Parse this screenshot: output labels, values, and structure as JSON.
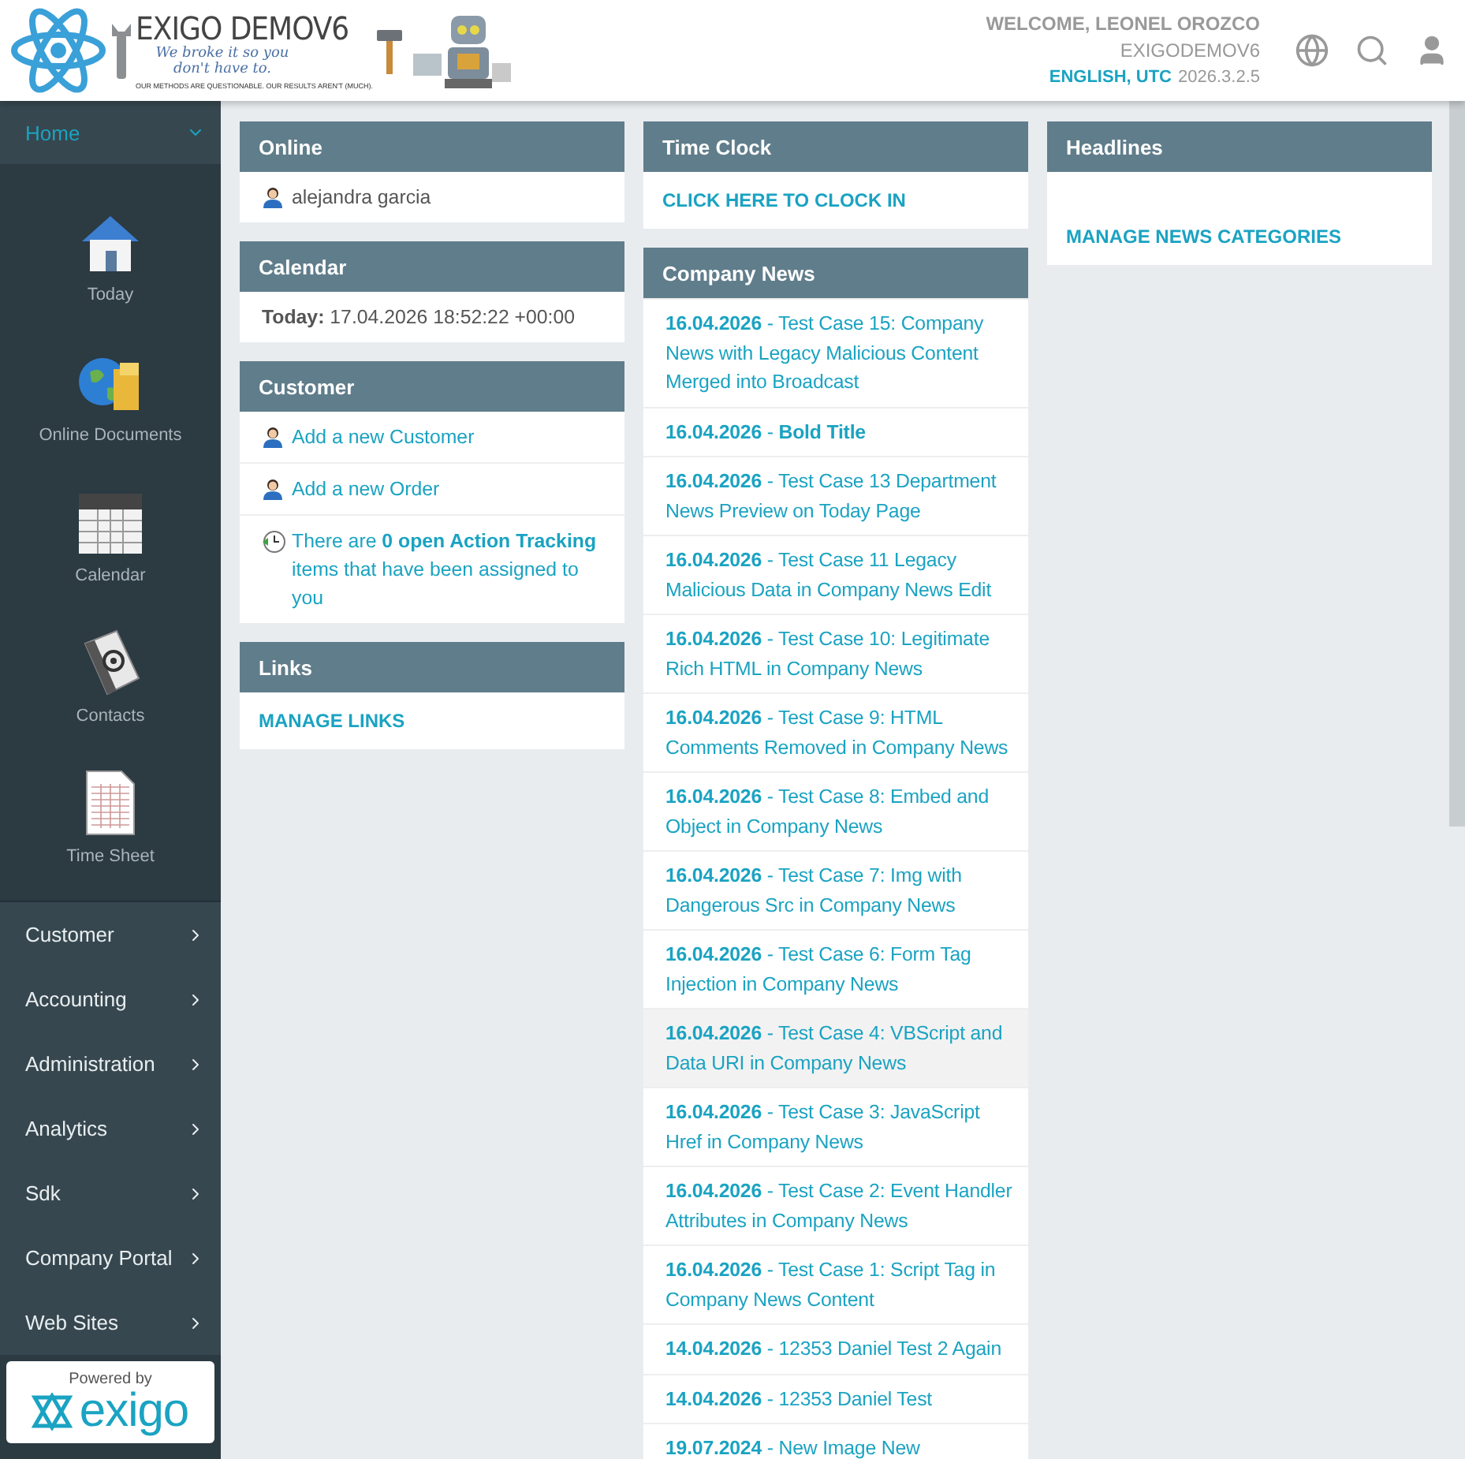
{
  "logo": {
    "title": "EXIGO DEMOV6",
    "tagline": "We broke it so you don't have to.",
    "motto": "OUR METHODS ARE QUESTIONABLE. OUR RESULTS AREN'T (MUCH)."
  },
  "header": {
    "welcome": "WELCOME, LEONEL OROZCO",
    "company": "EXIGODEMOV6",
    "locale": "ENGLISH, UTC",
    "version": "2026.3.2.5"
  },
  "sidebar": {
    "home": {
      "label": "Home",
      "expanded": true
    },
    "shortcuts": [
      {
        "label": "Today",
        "kind": "house"
      },
      {
        "label": "Online Documents",
        "kind": "documents"
      },
      {
        "label": "Calendar",
        "kind": "calendar"
      },
      {
        "label": "Contacts",
        "kind": "contacts"
      },
      {
        "label": "Time Sheet",
        "kind": "sheet"
      }
    ],
    "items": [
      "Customer",
      "Accounting",
      "Administration",
      "Analytics",
      "Sdk",
      "Company Portal",
      "Web Sites"
    ],
    "powered": {
      "caption": "Powered by",
      "brand": "exigo"
    }
  },
  "online": {
    "title": "Online",
    "users": [
      "alejandra garcia"
    ]
  },
  "calendar": {
    "title": "Calendar",
    "label": "Today:",
    "value": "17.04.2026 18:52:22 +00:00"
  },
  "customer": {
    "title": "Customer",
    "links": [
      "Add a new Customer",
      "Add a new Order"
    ],
    "tracking": "There are **0 open Action Tracking** items that have been assigned to you"
  },
  "links": {
    "title": "Links",
    "action": "MANAGE LINKS"
  },
  "time_clock": {
    "title": "Time Clock",
    "action": "CLICK HERE TO CLOCK IN"
  },
  "company_news": {
    "title": "Company News",
    "separator": "-",
    "items": [
      {
        "date": "16.04.2026",
        "title": "Test Case 15: Company News with Legacy Malicious Content Merged into Broadcast",
        "bold": false,
        "hovered": false
      },
      {
        "date": "16.04.2026",
        "title": "Bold Title",
        "bold": true,
        "hovered": false
      },
      {
        "date": "16.04.2026",
        "title": "Test Case 13 Department News Preview on Today Page",
        "bold": false,
        "hovered": false
      },
      {
        "date": "16.04.2026",
        "title": "Test Case 11 Legacy Malicious Data in Company News Edit",
        "bold": false,
        "hovered": false
      },
      {
        "date": "16.04.2026",
        "title": "Test Case 10: Legitimate Rich HTML in Company News",
        "bold": false,
        "hovered": false
      },
      {
        "date": "16.04.2026",
        "title": "Test Case 9: HTML Comments Removed in Company News",
        "bold": false,
        "hovered": false
      },
      {
        "date": "16.04.2026",
        "title": "Test Case 8: Embed and Object in Company News",
        "bold": false,
        "hovered": false
      },
      {
        "date": "16.04.2026",
        "title": "Test Case 7: Img with Dangerous Src in Company News",
        "bold": false,
        "hovered": false
      },
      {
        "date": "16.04.2026",
        "title": "Test Case 6: Form Tag Injection in Company News",
        "bold": false,
        "hovered": false
      },
      {
        "date": "16.04.2026",
        "title": "Test Case 4: VBScript and Data URI in Company News",
        "bold": false,
        "hovered": true
      },
      {
        "date": "16.04.2026",
        "title": "Test Case 3: JavaScript Href in Company News",
        "bold": false,
        "hovered": false
      },
      {
        "date": "16.04.2026",
        "title": "Test Case 2: Event Handler Attributes in Company News",
        "bold": false,
        "hovered": false
      },
      {
        "date": "16.04.2026",
        "title": "Test Case 1: Script Tag in Company News Content",
        "bold": false,
        "hovered": false
      },
      {
        "date": "14.04.2026",
        "title": "12353 Daniel Test 2 Again",
        "bold": false,
        "hovered": false
      },
      {
        "date": "14.04.2026",
        "title": "12353 Daniel Test",
        "bold": false,
        "hovered": false
      },
      {
        "date": "19.07.2024",
        "title": "New Image New",
        "bold": false,
        "hovered": false
      }
    ]
  },
  "headlines": {
    "title": "Headlines",
    "action": "MANAGE NEWS CATEGORIES"
  }
}
